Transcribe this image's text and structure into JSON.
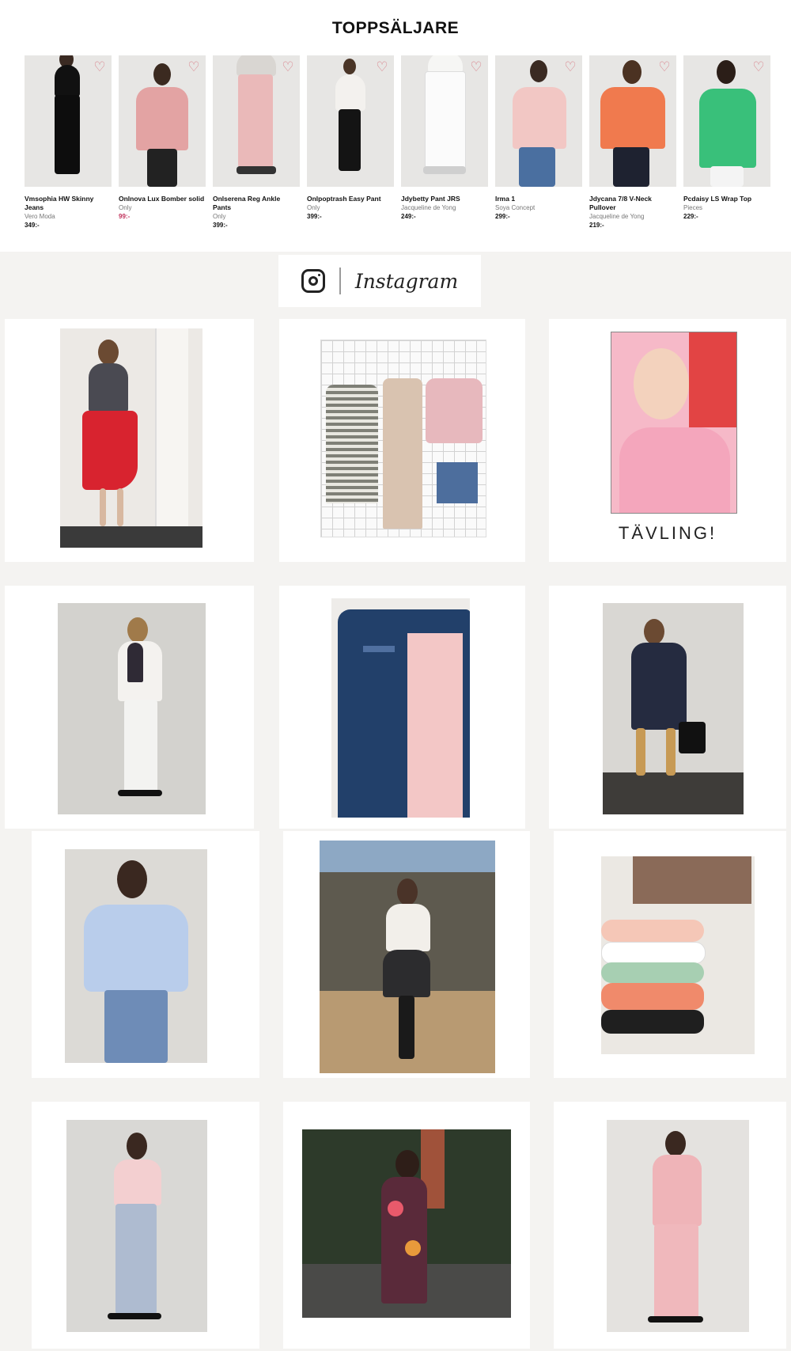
{
  "top_sellers": {
    "title": "TOPPSÄLJARE",
    "products": [
      {
        "name": "Vmsophia HW Skinny Jeans",
        "brand": "Vero Moda",
        "price": "349:-",
        "sale": false
      },
      {
        "name": "Onlnova Lux Bomber solid",
        "brand": "Only",
        "price": "99:-",
        "sale": true
      },
      {
        "name": "Onlserena Reg Ankle Pants",
        "brand": "Only",
        "price": "399:-",
        "sale": false
      },
      {
        "name": "Onlpoptrash Easy Pant",
        "brand": "Only",
        "price": "399:-",
        "sale": false
      },
      {
        "name": "Jdybetty Pant JRS",
        "brand": "Jacqueline de Yong",
        "price": "249:-",
        "sale": false
      },
      {
        "name": "Irma 1",
        "brand": "Soya Concept",
        "price": "299:-",
        "sale": false
      },
      {
        "name": "Jdycana 7/8 V-Neck Pullover",
        "brand": "Jacqueline de Yong",
        "price": "219:-",
        "sale": false
      },
      {
        "name": "Pcdaisy LS Wrap Top",
        "brand": "Pieces",
        "price": "229:-",
        "sale": false
      }
    ],
    "wishlist_icon": "heart-outline-icon"
  },
  "instagram": {
    "icon": "instagram-icon",
    "label": "Instagram",
    "contest_caption": "TÄVLING!"
  },
  "colors": {
    "page_bg": "#f4f3f1",
    "card_bg": "#ffffff",
    "heart": "#d9808a",
    "sale_price": "#c0305a"
  }
}
